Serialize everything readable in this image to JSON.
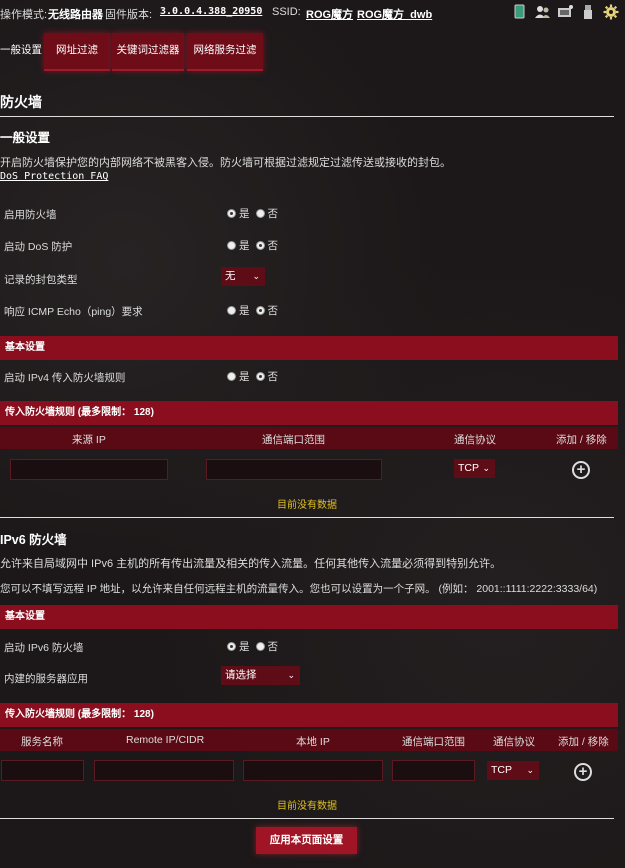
{
  "topbar": {
    "mode_label": "操作模式:",
    "mode_value": "无线路由器",
    "firmware_label": "固件版本:",
    "firmware_value": "3.0.0.4.388_20950",
    "ssid_label": "SSID:",
    "ssid1": "ROG魔方",
    "ssid2": "ROG魔方_dwb",
    "icons": [
      "sd-card-icon",
      "users-icon",
      "network-device-icon",
      "usb-icon",
      "settings-gear-icon"
    ]
  },
  "tabs": [
    "一般设置",
    "网址过滤",
    "关键词过滤器",
    "网络服务过滤"
  ],
  "page_title": "防火墙",
  "general": {
    "title": "一般设置",
    "desc": "开启防火墙保护您的内部网络不被黑客入侵。防火墙可根据过滤规定过滤传送或接收的封包。",
    "faq_link": "DoS Protection FAQ",
    "rows": [
      {
        "label": "启用防火墙",
        "selected": "yes"
      },
      {
        "label": "启动 DoS 防护",
        "selected": "no"
      },
      {
        "label": "记录的封包类型",
        "select_value": "无"
      },
      {
        "label": "响应 ICMP Echo（ping）要求",
        "selected": "no"
      }
    ],
    "yes": "是",
    "no": "否"
  },
  "basic_v4": {
    "header": "基本设置",
    "row_label": "启动 IPv4 传入防火墙规则",
    "selected": "no"
  },
  "inbound_v4": {
    "header": "传入防火墙规则 (最多限制： 128)",
    "columns": [
      "来源 IP",
      "通信端口范围",
      "通信协议",
      "添加 / 移除"
    ],
    "protocol": "TCP",
    "empty": "目前没有数据"
  },
  "ipv6": {
    "title": "IPv6 防火墙",
    "desc1": "允许来自局域网中 IPv6 主机的所有传出流量及相关的传入流量。任何其他传入流量必须得到特别允许。",
    "desc2": "您可以不填写远程 IP 地址，以允许来自任何远程主机的流量传入。您也可以设置为一个子网。 (例如： 2001::1111:2222:3333/64)",
    "basic_header": "基本设置",
    "enable_label": "启动 IPv6 防火墙",
    "enable_selected": "yes",
    "server_label": "内建的服务器应用",
    "server_select": "请选择"
  },
  "inbound_v6": {
    "header": "传入防火墙规则 (最多限制： 128)",
    "columns": [
      "服务名称",
      "Remote IP/CIDR",
      "本地 IP",
      "通信端口范围",
      "通信协议",
      "添加 / 移除"
    ],
    "protocol": "TCP",
    "empty": "目前没有数据"
  },
  "apply_button": "应用本页面设置"
}
